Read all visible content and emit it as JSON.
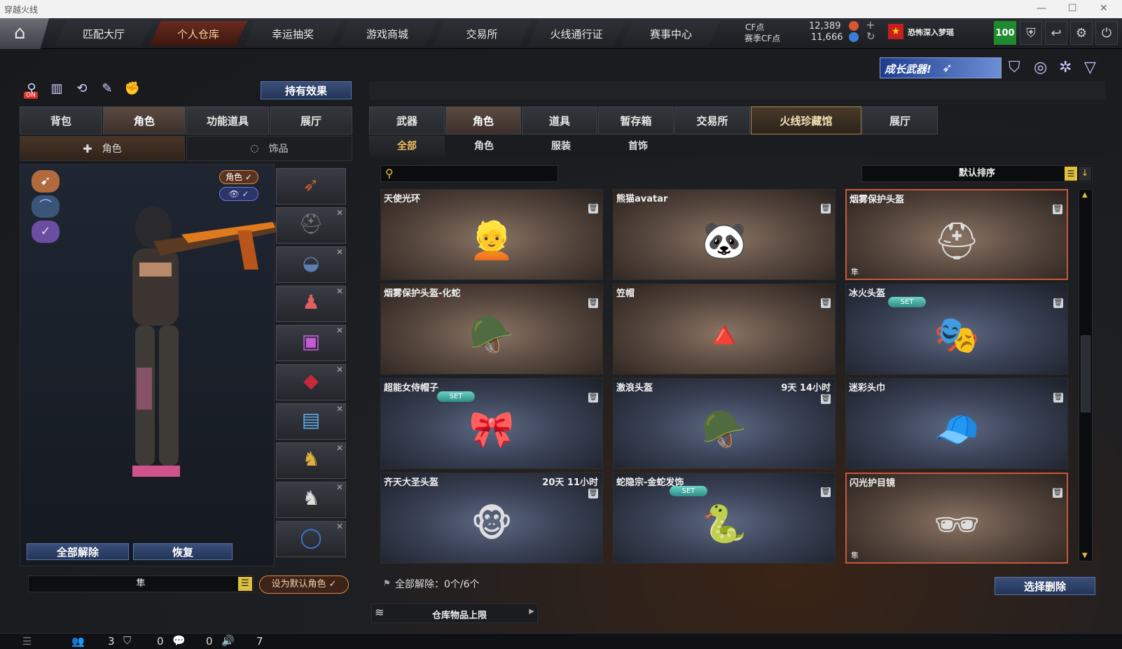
{
  "window": {
    "title": "穿越火线",
    "controls": [
      "—",
      "☐",
      "✕"
    ]
  },
  "nav": {
    "tabs": [
      {
        "label": "匹配大厅",
        "active": false
      },
      {
        "label": "个人仓库",
        "active": true
      },
      {
        "label": "幸运抽奖",
        "active": false
      },
      {
        "label": "游戏商城",
        "active": false
      },
      {
        "label": "交易所",
        "active": false
      },
      {
        "label": "火线通行证",
        "active": false
      },
      {
        "label": "赛事中心",
        "active": false
      }
    ],
    "cf_label": "CF点",
    "cf_value": "12,389",
    "season_cf_label": "赛季CF点",
    "season_cf_value": "11,666",
    "plus": "+",
    "refresh": "↻",
    "username": "恐怖深入梦瑶",
    "level": "100",
    "badge_icon": "shield-icon",
    "icons": [
      "shield-icon",
      "back-icon",
      "gear-icon",
      "power-icon"
    ]
  },
  "banner": {
    "text": "成长武器!"
  },
  "left": {
    "toolbar_icons": [
      "on-toggle-icon",
      "stats-icon",
      "history-icon",
      "wrench-icon",
      "grab-icon"
    ],
    "on_label": "ON",
    "hold_effect_button": "持有效果",
    "tabs": [
      "背包",
      "角色",
      "功能道具",
      "展厅"
    ],
    "active_tab": 1,
    "subtabs": [
      "角色",
      "饰品"
    ],
    "role_toggle": "角色 ✓",
    "eye_toggle": "👁 ✓",
    "side_emblems": [
      "hawk-emblem-icon",
      "wing-emblem-icon",
      "bird-emblem-icon"
    ],
    "slots": [
      "rifle-icon",
      "helmet-icon",
      "goggles-icon",
      "pendant-icon",
      "box-icon",
      "bag-icon",
      "battery-icon",
      "wolf-icon",
      "wolf-silver-icon",
      "ring-icon"
    ],
    "unequip_all_button": "全部解除",
    "restore_button": "恢复",
    "name_field": "隼",
    "set_default_button": "设为默认角色 ✓"
  },
  "right": {
    "tabs": [
      "武器",
      "角色",
      "道具",
      "暂存箱",
      "交易所",
      "火线珍藏馆",
      "展厅"
    ],
    "active_tab": 1,
    "gold_tab": 5,
    "subtabs": [
      "全部",
      "角色",
      "服装",
      "首饰"
    ],
    "active_subtab": 0,
    "search_placeholder": "",
    "sort_label": "默认排序",
    "items": [
      {
        "name": "天使光环",
        "time": "",
        "set": false,
        "collection": "",
        "icon": "👱",
        "theme": "brown",
        "selected": false
      },
      {
        "name": "熊猫avatar",
        "time": "",
        "set": false,
        "collection": "",
        "icon": "🐼",
        "theme": "brown",
        "selected": false
      },
      {
        "name": "烟雾保护头盔",
        "time": "",
        "set": false,
        "collection": "隼",
        "icon": "⛑",
        "theme": "brown",
        "selected": true
      },
      {
        "name": "烟雾保护头盔-化蛇",
        "time": "",
        "set": false,
        "collection": "",
        "icon": "🪖",
        "theme": "brown",
        "selected": false
      },
      {
        "name": "笠帽",
        "time": "",
        "set": false,
        "collection": "",
        "icon": "🔺",
        "theme": "brown",
        "selected": false
      },
      {
        "name": "冰火头盔",
        "time": "",
        "set": true,
        "collection": "",
        "icon": "🎭",
        "theme": "blue",
        "selected": false
      },
      {
        "name": "超能女侍帽子",
        "time": "",
        "set": true,
        "collection": "",
        "icon": "🎀",
        "theme": "blue",
        "selected": false
      },
      {
        "name": "激浪头盔",
        "time": "9天 14小时",
        "set": false,
        "collection": "",
        "icon": "🪖",
        "theme": "blue",
        "selected": false
      },
      {
        "name": "迷彩头巾",
        "time": "",
        "set": false,
        "collection": "",
        "icon": "🧢",
        "theme": "blue",
        "selected": false
      },
      {
        "name": "齐天大圣头盔",
        "time": "20天 11小时",
        "set": false,
        "collection": "",
        "icon": "🐵",
        "theme": "blue",
        "selected": false
      },
      {
        "name": "蛇隐宗-金蛇发饰",
        "time": "",
        "set": true,
        "collection": "",
        "icon": "🐍",
        "theme": "blue",
        "selected": false
      },
      {
        "name": "闪光护目镜",
        "time": "",
        "set": false,
        "collection": "隼",
        "icon": "🕶",
        "theme": "brown",
        "selected": true
      }
    ],
    "set_label": "SET",
    "unequip_status": "全部解除：0个/6个",
    "select_delete_button": "选择删除",
    "capacity_label": "仓库物品上限"
  },
  "status": {
    "friends_count": "3",
    "clan_count": "0",
    "chat_count": "0",
    "volume": "7"
  },
  "colors": {
    "accent": "#c9583f",
    "set": "#4fb3a8",
    "level_bg": "#1f8a2e"
  }
}
